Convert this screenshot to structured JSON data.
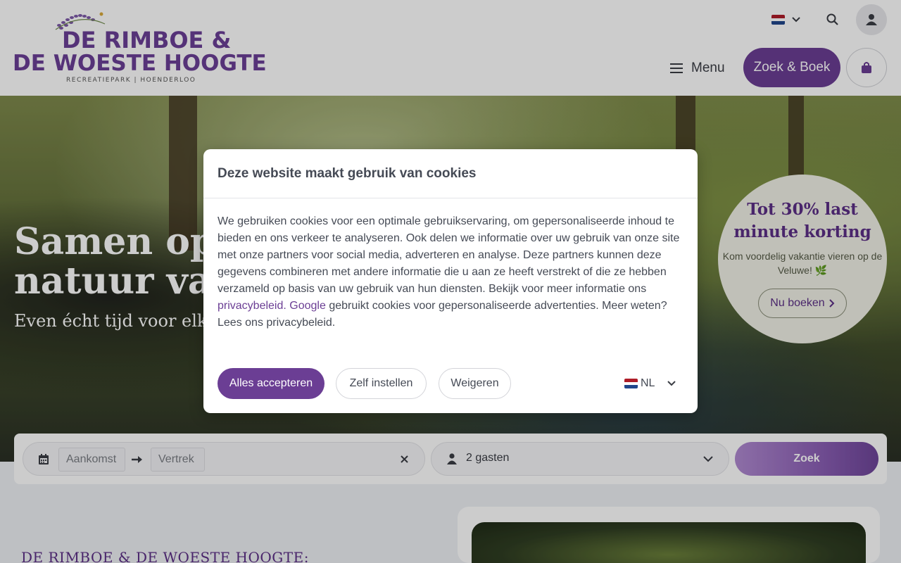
{
  "brand": {
    "line1": "DE RIMBOE &",
    "line2": "DE WOESTE HOOGTE",
    "subtitle": "RECREATIEPARK | HOENDERLOO"
  },
  "header": {
    "menu_label": "Menu",
    "book_label": "Zoek & Boek",
    "flag_colors": [
      "#ae1c28",
      "#ffffff",
      "#21468b"
    ]
  },
  "hero": {
    "title_line1": "Samen oplad",
    "title_line2": "natuur van d",
    "subtitle": "Even écht tijd voor elkaar"
  },
  "promo": {
    "title": "Tot 30% last minute korting",
    "text": "Kom voordelig vakantie vieren op de Veluwe! 🌿",
    "button_label": "Nu boeken"
  },
  "search": {
    "arrival_placeholder": "Aankomst",
    "departure_placeholder": "Vertrek",
    "guests_label": "2 gasten",
    "submit_label": "Zoek"
  },
  "content": {
    "intro_heading": "DE RIMBOE & DE WOESTE HOOGTE:"
  },
  "cookie_modal": {
    "title": "Deze website maakt gebruik van cookies",
    "body_part1": "We gebruiken cookies voor een optimale gebruikservaring, om gepersonaliseerde inhoud te bieden en ons verkeer te analyseren. Ook delen we informatie over uw gebruik van onze site met onze partners voor social media, adverteren en analyse. Deze partners kunnen deze gegevens combineren met andere informatie die u aan ze heeft verstrekt of die ze hebben verzameld op basis van uw gebruik van hun diensten. Bekijk voor meer informatie ons ",
    "privacy_link": "privacybeleid.",
    "google_link": "Google",
    "body_part2": " gebruikt cookies voor gepersonaliseerde advertenties. Meer weten? Lees ons privacybeleid.",
    "accept_label": "Alles accepteren",
    "settings_label": "Zelf instellen",
    "reject_label": "Weigeren",
    "language": "NL"
  },
  "colors": {
    "brand_purple": "#6b3e94",
    "promo_bg": "#f0f1e6"
  }
}
